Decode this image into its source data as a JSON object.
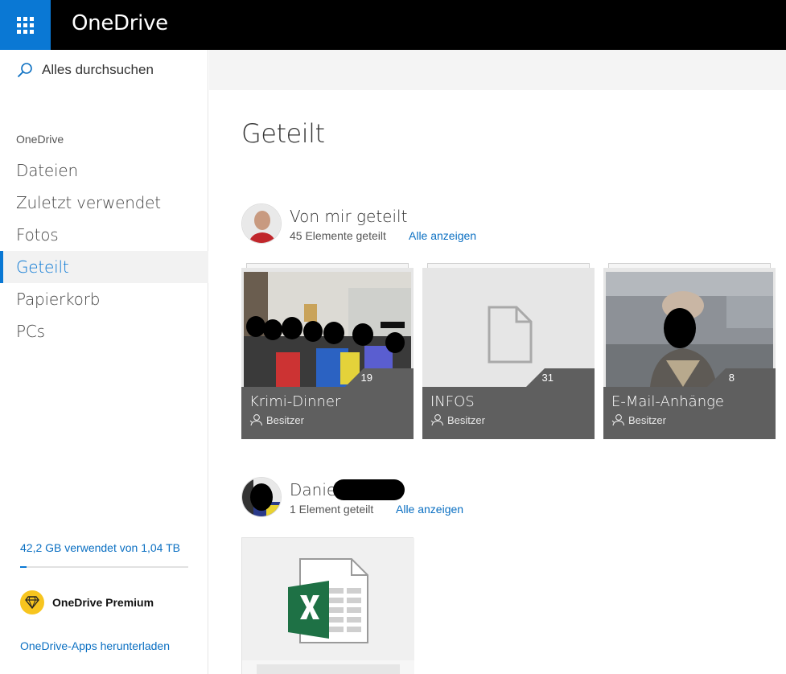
{
  "header": {
    "app_title": "OneDrive",
    "waffle_icon": "app-launcher-icon",
    "bar_color": "#000000",
    "accent_color": "#0a78d4"
  },
  "sidebar": {
    "search_placeholder": "Alles durchsuchen",
    "section_heading": "OneDrive",
    "items": [
      {
        "label": "Dateien",
        "active": false
      },
      {
        "label": "Zuletzt verwendet",
        "active": false
      },
      {
        "label": "Fotos",
        "active": false
      },
      {
        "label": "Geteilt",
        "active": true
      },
      {
        "label": "Papierkorb",
        "active": false
      },
      {
        "label": "PCs",
        "active": false
      }
    ],
    "storage_text": "42,2 GB verwendet von 1,04 TB",
    "storage_fraction": 0.04,
    "premium_label": "OneDrive Premium",
    "apps_link": "OneDrive-Apps herunterladen"
  },
  "main": {
    "page_title": "Geteilt",
    "groups": [
      {
        "owner": "Von mir geteilt",
        "count_text": "45 Elemente geteilt",
        "link": "Alle anzeigen",
        "tiles": [
          {
            "name": "Krimi-Dinner",
            "count": "19",
            "role": "Besitzer",
            "thumb": "photo-group"
          },
          {
            "name": "INFOS",
            "count": "31",
            "role": "Besitzer",
            "thumb": "document-icon"
          },
          {
            "name": "E-Mail-Anhänge",
            "count": "8",
            "role": "Besitzer",
            "thumb": "photo-portrait"
          }
        ]
      },
      {
        "owner": "Daniel",
        "count_text": "1 Element geteilt",
        "link": "Alle anzeigen",
        "tiles": [
          {
            "thumb": "excel-icon"
          }
        ]
      }
    ]
  }
}
